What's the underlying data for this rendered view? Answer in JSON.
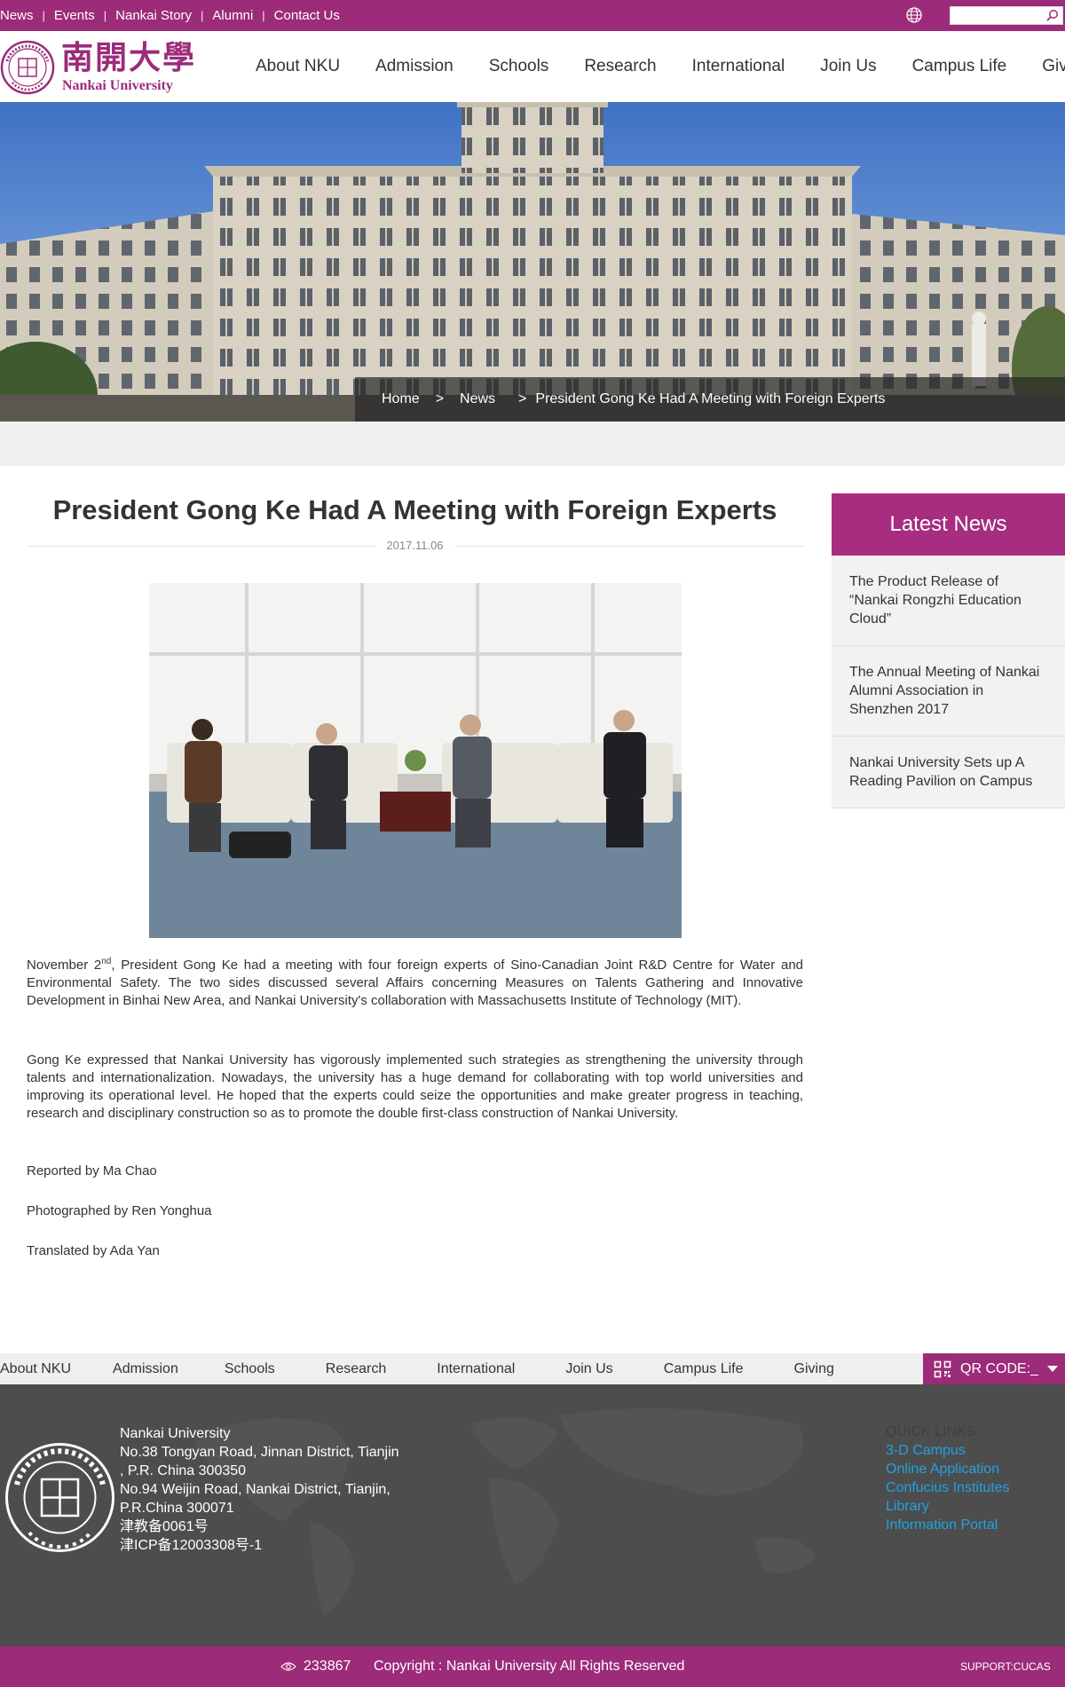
{
  "topbar": {
    "links": [
      "News",
      "Events",
      "Nankai Story",
      "Alumni",
      "Contact Us"
    ],
    "search_placeholder": ""
  },
  "header": {
    "logo_cn": "南開大學",
    "logo_en": "Nankai University",
    "nav": [
      "About NKU",
      "Admission",
      "Schools",
      "Research",
      "International",
      "Join Us",
      "Campus Life",
      "Giving"
    ]
  },
  "breadcrumb": {
    "home": "Home",
    "sep": ">",
    "section": "News",
    "current": "President Gong Ke Had A Meeting with Foreign Experts"
  },
  "article": {
    "title": "President Gong Ke Had A Meeting with Foreign Experts",
    "date": "2017.11.06",
    "p1_pre": "November 2",
    "p1_sup": "nd",
    "p1_post": ", President Gong Ke had a meeting with four foreign experts of Sino-Canadian Joint R&D Centre for Water and Environmental Safety. The two sides discussed several Affairs concerning Measures on Talents Gathering and Innovative Development in Binhai New Area, and Nankai University's collaboration with Massachusetts Institute of Technology (MIT).",
    "p2": "Gong Ke expressed that Nankai University has vigorously implemented such strategies as strengthening the university through talents and internationalization. Nowadays, the university has a huge demand for collaborating with top world universities and improving its operational level. He hoped that the experts could seize the opportunities and make greater progress in teaching, research and disciplinary construction so as to promote the double first-class construction of Nankai University.",
    "reported": "Reported by Ma Chao",
    "photographed": "Photographed by Ren Yonghua",
    "translated": "Translated by Ada Yan"
  },
  "sidebar": {
    "title": "Latest News",
    "items": [
      "The Product Release of “Nankai Rongzhi Education Cloud”",
      "The Annual Meeting of Nankai Alumni Association in Shenzhen 2017",
      "Nankai University Sets up A Reading Pavilion on Campus"
    ]
  },
  "footer": {
    "nav": [
      "About NKU",
      "Admission",
      "Schools",
      "Research",
      "International",
      "Join Us",
      "Campus Life",
      "Giving"
    ],
    "qr_label": "QR CODE:_",
    "address_lines": [
      "Nankai University",
      "No.38 Tongyan Road, Jinnan District, Tianjin",
      ", P.R. China 300350",
      "No.94 Weijin Road,  Nankai District, Tianjin,",
      "P.R.China  300071",
      "津教备0061号",
      "津ICP备12003308号-1"
    ],
    "quick_title": "QUICK LINKS",
    "quick_links": [
      "3-D Campus",
      "Online Application",
      "Confucius Institutes",
      "Library",
      "Information Portal"
    ],
    "visits": "233867",
    "copyright": "Copyright : Nankai University All Rights Reserved",
    "support": "SUPPORT:CUCAS"
  },
  "colors": {
    "brand": "#9c2b7a",
    "link": "#1fa3e0",
    "footer_bg": "#4d4d4d"
  },
  "icons": [
    "globe-icon",
    "search-icon",
    "logo-seal",
    "qr-code-icon",
    "eye-icon"
  ]
}
